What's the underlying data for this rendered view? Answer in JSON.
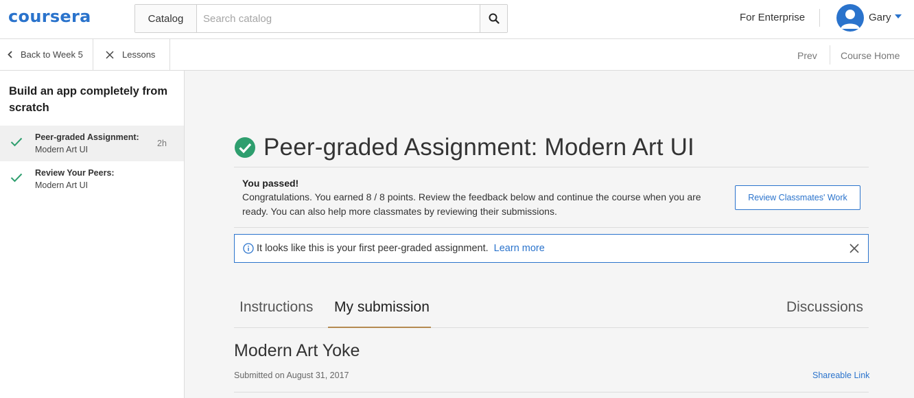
{
  "header": {
    "logo": "coursera",
    "catalog_label": "Catalog",
    "search_placeholder": "Search catalog",
    "enterprise_label": "For Enterprise",
    "user_name": "Gary"
  },
  "subnav": {
    "back_label": "Back to Week 5",
    "lessons_label": "Lessons",
    "prev_label": "Prev",
    "course_home_label": "Course Home"
  },
  "sidebar": {
    "title": "Build an app completely from scratch",
    "items": [
      {
        "line1": "Peer-graded Assignment:",
        "line2": "Modern Art UI",
        "duration": "2h",
        "completed": true,
        "active": true
      },
      {
        "line1": "Review Your Peers:",
        "line2": "Modern Art UI",
        "duration": "",
        "completed": true,
        "active": false
      }
    ]
  },
  "main": {
    "title": "Peer-graded Assignment: Modern Art UI",
    "passed_title": "You passed!",
    "passed_body": "Congratulations. You earned 8 / 8 points. Review the feedback below and continue the course when you are ready. You can also help more classmates by reviewing their submissions.",
    "review_button": "Review Classmates' Work",
    "info_text": "It looks like this is your first peer-graded assignment.",
    "learn_more": "Learn more",
    "tabs": [
      {
        "label": "Instructions",
        "active": false
      },
      {
        "label": "My submission",
        "active": true
      },
      {
        "label": "Discussions",
        "active": false
      }
    ],
    "submission_title": "Modern Art Yoke",
    "submission_date": "Submitted on August 31, 2017",
    "shareable_link": "Shareable Link"
  },
  "colors": {
    "brand_blue": "#2a73cc",
    "success_green": "#2e9e6e",
    "tab_underline": "#b58a50"
  },
  "icons": {
    "search": "search-icon",
    "back": "chevron-left-icon",
    "lessons": "close-icon",
    "user_menu": "caret-down-icon",
    "completed": "check-icon",
    "info": "info-icon",
    "dismiss": "close-icon"
  }
}
